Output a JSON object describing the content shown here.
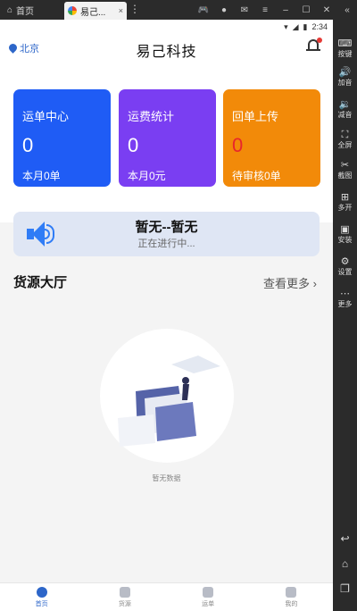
{
  "emulator": {
    "home_label": "首页",
    "tab_label": "易己...",
    "tab_close": "×",
    "more_dots": "⋮",
    "sidebar": [
      {
        "icon": "keyboard-icon",
        "glyph": "⌨",
        "label": "按键"
      },
      {
        "icon": "volume-up-icon",
        "glyph": "🔊",
        "label": "加音"
      },
      {
        "icon": "volume-down-icon",
        "glyph": "🔉",
        "label": "减音"
      },
      {
        "icon": "fullscreen-icon",
        "glyph": "⛶",
        "label": "全屏"
      },
      {
        "icon": "scissors-icon",
        "glyph": "✂",
        "label": "截图"
      },
      {
        "icon": "multi-open-icon",
        "glyph": "⊞",
        "label": "多开"
      },
      {
        "icon": "apk-install-icon",
        "glyph": "▣",
        "label": "安装"
      },
      {
        "icon": "settings-icon",
        "glyph": "⚙",
        "label": "设置"
      },
      {
        "icon": "more-icon",
        "glyph": "⋯",
        "label": "更多"
      }
    ],
    "nav": [
      "↩",
      "⌂",
      "❐"
    ]
  },
  "statusbar": {
    "time": "2:34"
  },
  "header": {
    "location": "北京",
    "title": "易己科技"
  },
  "cards": [
    {
      "title": "运单中心",
      "value": "0",
      "sub": "本月0单",
      "color": "#1f5cf5",
      "value_color": "#ffffff"
    },
    {
      "title": "运费统计",
      "value": "0",
      "sub": "本月0元",
      "color": "#7a3ef2",
      "value_color": "#ffffff"
    },
    {
      "title": "回单上传",
      "value": "0",
      "sub": "待审核0单",
      "color": "#f28a09",
      "value_color": "#e8262c"
    }
  ],
  "notice": {
    "title": "暂无--暂无",
    "subtitle": "正在进行中..."
  },
  "section": {
    "title": "货源大厅",
    "more": "查看更多"
  },
  "empty": {
    "text": "暂无数据"
  },
  "tabs": [
    {
      "label": "首页",
      "active": true
    },
    {
      "label": "货源",
      "active": false
    },
    {
      "label": "运单",
      "active": false
    },
    {
      "label": "我的",
      "active": false
    }
  ]
}
